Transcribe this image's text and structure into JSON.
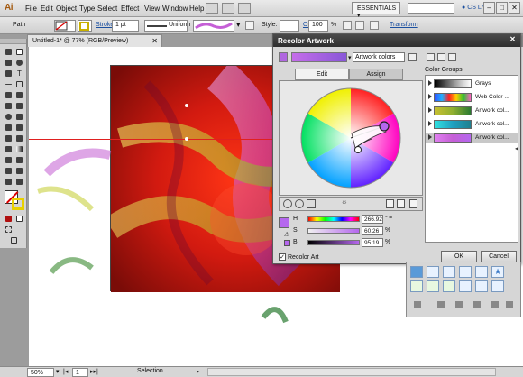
{
  "menubar": {
    "logo": "Ai",
    "items": [
      "File",
      "Edit",
      "Object",
      "Type",
      "Select",
      "Effect",
      "View",
      "Window",
      "Help"
    ],
    "workspace": "ESSENTIALS",
    "cs_live": "CS Live",
    "window_buttons": [
      "–",
      "□",
      "✕"
    ]
  },
  "controlbar": {
    "selection_type": "Path",
    "stroke_label": "Stroke:",
    "stroke_value": "1 pt",
    "profile": "Uniform",
    "style_label": "Style:",
    "opacity_label": "Opacity:",
    "opacity_value": "100",
    "opacity_unit": "%",
    "transform_link": "Transform"
  },
  "document": {
    "tab_title": "Untitled-1* @ 77% (RGB/Preview)",
    "close": "✕"
  },
  "statusbar": {
    "zoom": "50%",
    "page": "1",
    "tool": "Selection"
  },
  "dialog": {
    "title": "Recolor Artwork",
    "close": "✕",
    "name_field": "Artwork colors",
    "tabs": [
      "Edit",
      "Assign"
    ],
    "active_tab": "Edit",
    "hsb": [
      {
        "label": "H",
        "value": "266.92",
        "unit": "°"
      },
      {
        "label": "S",
        "value": "60.26",
        "unit": "%"
      },
      {
        "label": "B",
        "value": "95.19",
        "unit": "%"
      }
    ],
    "recolor_checkbox": "Recolor Art",
    "recolor_checked": true,
    "ok": "OK",
    "cancel": "Cancel",
    "color_groups_label": "Color Groups",
    "groups": [
      {
        "name": "Grays"
      },
      {
        "name": "Web Color ..."
      },
      {
        "name": "Artwork col..."
      },
      {
        "name": "Artwork col..."
      },
      {
        "name": "Artwork col..."
      }
    ],
    "current_color": "#b567ee"
  },
  "colors": {
    "accent_purple": "#b567ee",
    "artboard_red": "#c01d10",
    "guide_red": "#e02020"
  }
}
